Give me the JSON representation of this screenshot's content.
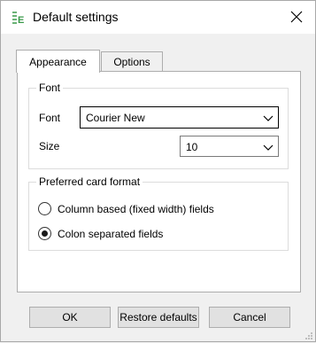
{
  "window": {
    "title": "Default settings",
    "app_icon": "app-logo-icon",
    "close_icon": "close-icon"
  },
  "tabs": [
    {
      "label": "Appearance",
      "selected": true
    },
    {
      "label": "Options",
      "selected": false
    }
  ],
  "font_group": {
    "title": "Font",
    "font_label": "Font",
    "font_value": "Courier New",
    "size_label": "Size",
    "size_value": "10"
  },
  "format_group": {
    "title": "Preferred card format",
    "options": [
      {
        "label": "Column based (fixed width) fields",
        "selected": false
      },
      {
        "label": "Colon separated fields",
        "selected": true
      }
    ]
  },
  "buttons": {
    "ok": "OK",
    "restore": "Restore defaults",
    "cancel": "Cancel"
  },
  "colors": {
    "window_bg": "#f0f0f0",
    "panel_bg": "#ffffff",
    "button_bg": "#e1e1e1",
    "app_icon_green": "#3a9a4a"
  }
}
